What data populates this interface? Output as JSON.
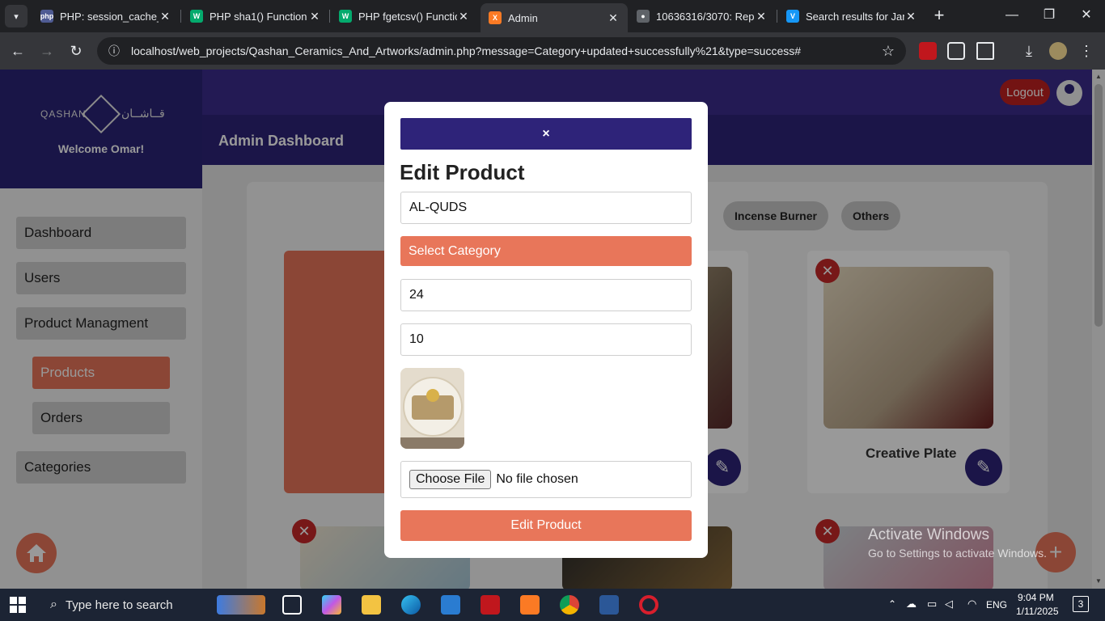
{
  "browser": {
    "tabs": [
      {
        "title": "PHP: session_cache_e",
        "favicon": "php-icon",
        "color": "#4f5b93",
        "active": false
      },
      {
        "title": "PHP sha1() Function",
        "favicon": "w3schools-icon",
        "color": "#04aa6d",
        "active": false
      },
      {
        "title": "PHP fgetcsv() Functio",
        "favicon": "w3schools-icon",
        "color": "#04aa6d",
        "active": false
      },
      {
        "title": "Admin",
        "favicon": "xampp-icon",
        "color": "#fb7a24",
        "active": true
      },
      {
        "title": "10636316/3070: Rep",
        "favicon": "git-icon",
        "color": "#5f6368",
        "active": false
      },
      {
        "title": "Search results for Jar",
        "favicon": "vuetify-icon",
        "color": "#1697f6",
        "active": false
      }
    ],
    "url": "localhost/web_projects/Qashan_Ceramics_And_Artworks/admin.php?message=Category+updated+successfully%21&type=success#"
  },
  "brand": {
    "name_latin": "QASHAN",
    "name_arabic": "قــاشــان",
    "welcome": "Welcome Omar!"
  },
  "sidebar": {
    "dashboard": "Dashboard",
    "users": "Users",
    "product_management": "Product Managment",
    "products": "Products",
    "orders": "Orders",
    "categories": "Categories"
  },
  "header": {
    "title": "Admin Dashboard",
    "logout": "Logout"
  },
  "filters": [
    "Incense Burner",
    "Others"
  ],
  "products": [
    {
      "title": "Creative Plate"
    }
  ],
  "modal": {
    "close_label": "×",
    "title": "Edit Product",
    "name_value": "AL-QUDS",
    "category_select": "Select Category",
    "price_value": "24",
    "quantity_value": "10",
    "file_button": "Choose File",
    "file_status": "No file chosen",
    "submit_label": "Edit Product"
  },
  "watermark": {
    "line1": "Activate Windows",
    "line2": "Go to Settings to activate Windows."
  },
  "taskbar": {
    "search_placeholder": "Type here to search",
    "language": "ENG",
    "time": "9:04 PM",
    "date": "1/11/2025",
    "notifications": "3"
  },
  "colors": {
    "brand_dark": "#2e2379",
    "accent": "#e8765a",
    "danger": "#c62828"
  }
}
